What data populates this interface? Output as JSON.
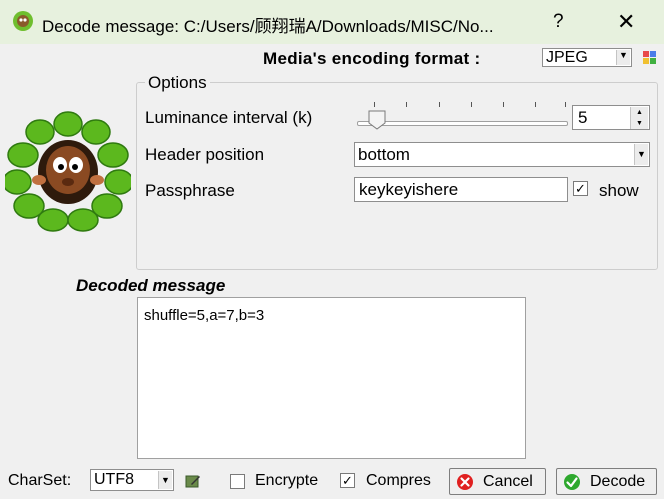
{
  "window": {
    "title": "Decode message: C:/Users/顾翔瑞A/Downloads/MISC/No...",
    "help": "?",
    "close": "✕"
  },
  "format": {
    "label": "Media's encoding format :",
    "value": "JPEG"
  },
  "options": {
    "legend": "Options",
    "luminance_label": "Luminance interval (k)",
    "luminance_value": "5",
    "header_label": "Header position",
    "header_value": "bottom",
    "passphrase_label": "Passphrase",
    "passphrase_value": "keykeyishere",
    "show_label": "show",
    "show_checked": true
  },
  "decoded": {
    "label": "Decoded message",
    "text": "shuffle=5,a=7,b=3"
  },
  "bottom": {
    "charset_label": "CharSet:",
    "charset_value": "UTF8",
    "encrypted_label": "Encrypte",
    "encrypted_checked": false,
    "compressed_label": "Compres",
    "compressed_checked": true,
    "cancel_label": "Cancel",
    "decode_label": "Decode"
  },
  "icons": {
    "app": "leafy-mascot-icon",
    "palette": "palette-icon",
    "charset_edit": "edit-icon",
    "cancel": "cancel-icon",
    "decode": "check-icon"
  },
  "colors": {
    "titlebar": "#e7f1de",
    "cancel_red": "#e02020",
    "decode_green": "#2ea82e"
  }
}
